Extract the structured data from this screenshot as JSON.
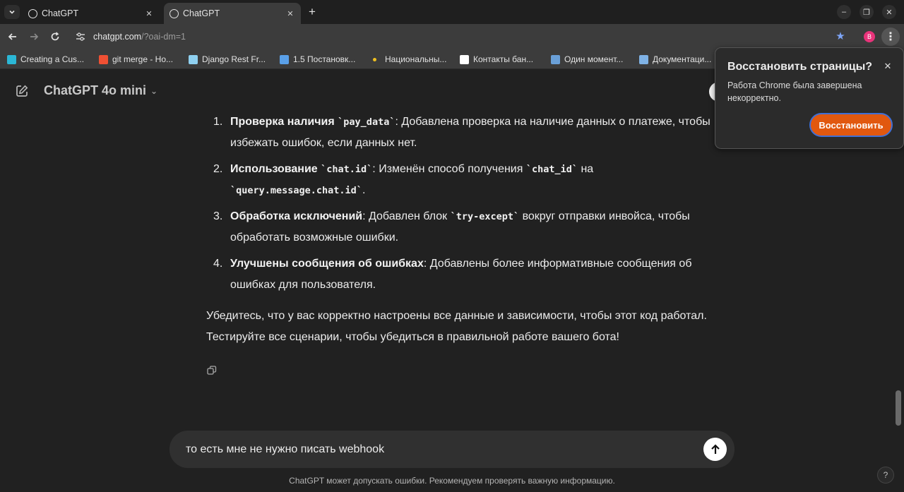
{
  "browser": {
    "tabs": [
      {
        "title": "ChatGPT",
        "active": false
      },
      {
        "title": "ChatGPT",
        "active": true
      }
    ],
    "url_host": "chatgpt.com",
    "url_path": "/?oai-dm=1",
    "profile_initial": "B",
    "bookmarks": [
      {
        "label": "Creating a Cus...",
        "icon": "cube-icon",
        "color": "#2bb7d6"
      },
      {
        "label": "git merge - Ho...",
        "icon": "git-icon",
        "color": "#f05033"
      },
      {
        "label": "Django Rest Fr...",
        "icon": "drf-icon",
        "color": "#8fd0f0"
      },
      {
        "label": "1.5 Постановк...",
        "icon": "bookmark-site-icon",
        "color": "#5aa0e8"
      },
      {
        "label": "Национальны...",
        "icon": "dot-icon",
        "color": "#f0c020"
      },
      {
        "label": "Контакты бан...",
        "icon": "bank-icon",
        "color": "#ffffff"
      },
      {
        "label": "Один момент...",
        "icon": "it-icon",
        "color": "#6aa0d8"
      },
      {
        "label": "Документаци...",
        "icon": "docs-icon",
        "color": "#7fb2e5"
      }
    ],
    "colors": {
      "accent_star": "#7ea5f7",
      "profile_bg": "#e8337a"
    }
  },
  "chat": {
    "model_label": "ChatGPT 4o mini",
    "items": [
      {
        "num": "1.",
        "bold": "Проверка наличия",
        "code": "`pay_data`",
        "rest": ": Добавлена проверка на наличие данных о платеже, чтобы избежать ошибок, если данных нет."
      },
      {
        "num": "2.",
        "bold": "Использование",
        "code": "`chat.id`",
        "rest_a": ": Изменён способ получения ",
        "code2": "`chat_id`",
        "rest_b": " на ",
        "code3": "`query.message.chat.id`",
        "rest_c": "."
      },
      {
        "num": "3.",
        "bold": "Обработка исключений",
        "rest_a": ": Добавлен блок ",
        "code": "`try-except`",
        "rest_b": " вокруг отправки инвойса, чтобы обработать возможные ошибки."
      },
      {
        "num": "4.",
        "bold": "Улучшены сообщения об ошибках",
        "rest": ": Добавлены более информативные сообщения об ошибках для пользователя."
      }
    ],
    "closing": "Убедитесь, что у вас корректно настроены все данные и зависимости, чтобы этот код работал. Тестируйте все сценарии, чтобы убедиться в правильной работе вашего бота!",
    "composer_text": "то есть мне не нужно писать webhook",
    "disclaimer": "ChatGPT может допускать ошибки. Рекомендуем проверять важную информацию.",
    "help_label": "?"
  },
  "restore_popup": {
    "title": "Восстановить страницы?",
    "body": "Работа Chrome была завершена некорректно.",
    "button": "Восстановить",
    "button_color": "#e1580f"
  }
}
